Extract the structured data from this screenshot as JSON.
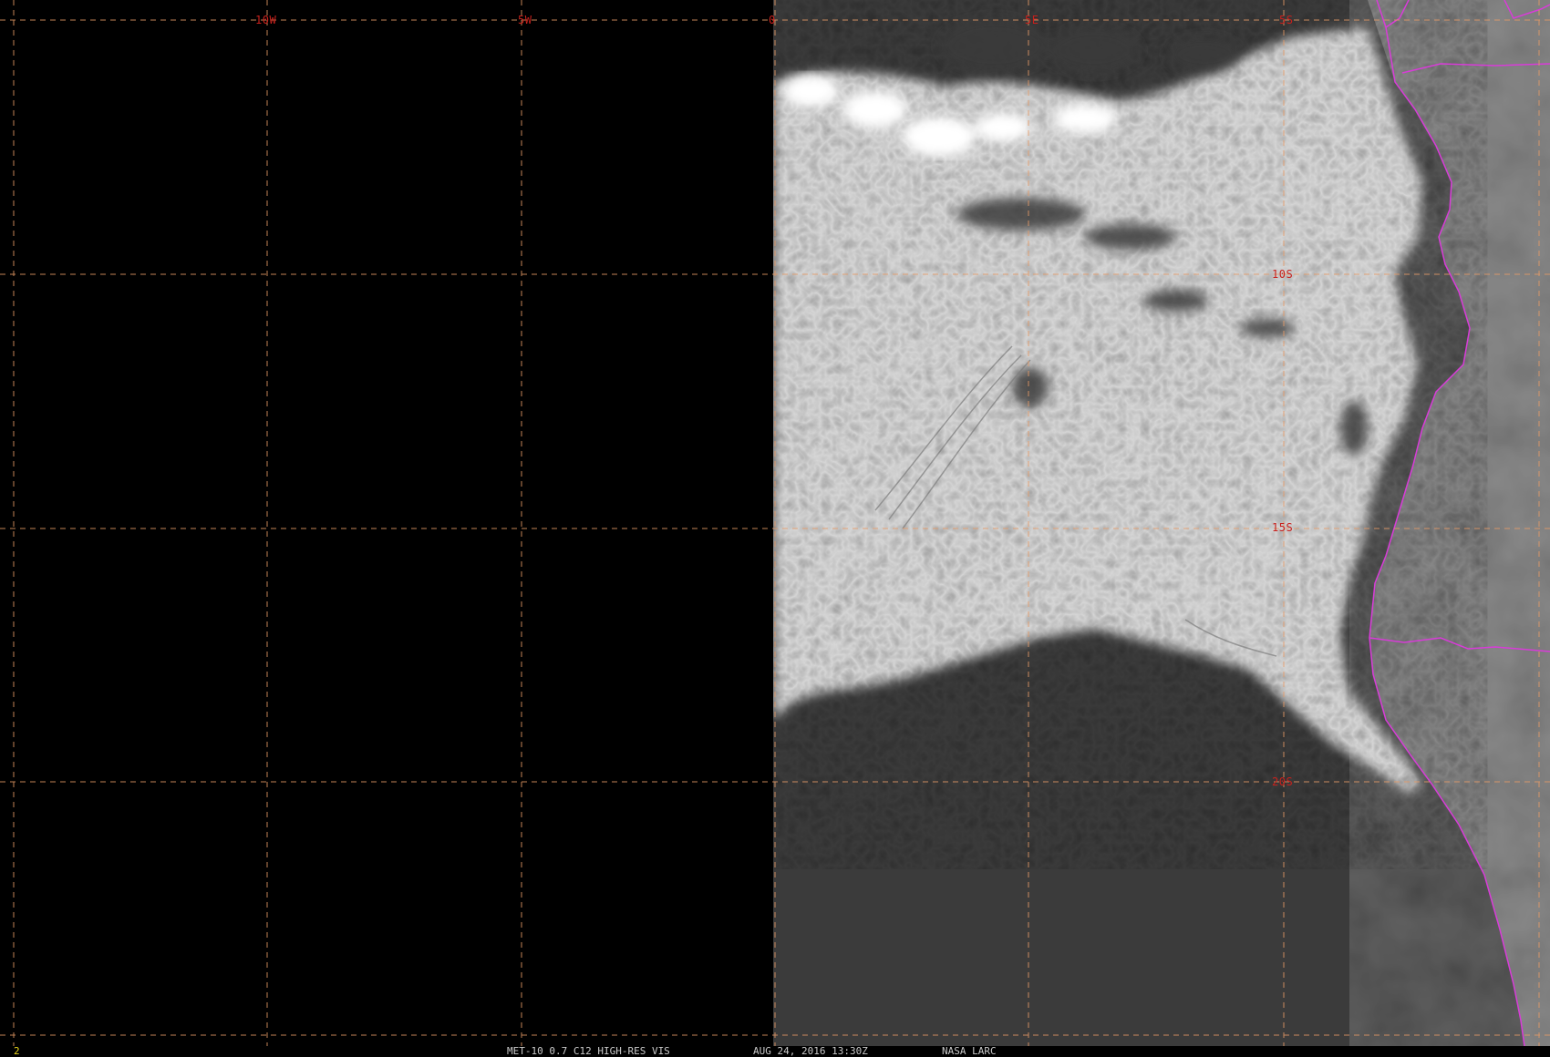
{
  "image": {
    "title": "MET-10 0.7 C12 HIGH-RES VIS",
    "timestamp": "AUG 24, 2016 13:30Z",
    "source": "NASA LARC",
    "frame_number": "2"
  },
  "grid": {
    "longitude_labels": [
      "10W",
      "5W",
      "0",
      "5E",
      "5S"
    ],
    "latitude_labels": [
      "10S",
      "15S",
      "20S"
    ],
    "line_color": "#e69a66"
  },
  "colors": {
    "background": "#000000",
    "ocean": "#3a3a3a",
    "land": "#6f6f6f",
    "cloud": "#e4e4e4",
    "border": "#d83cd8",
    "label": "#c8201c",
    "status_text": "#c9c9c9",
    "frame_number": "#e6d21a"
  }
}
